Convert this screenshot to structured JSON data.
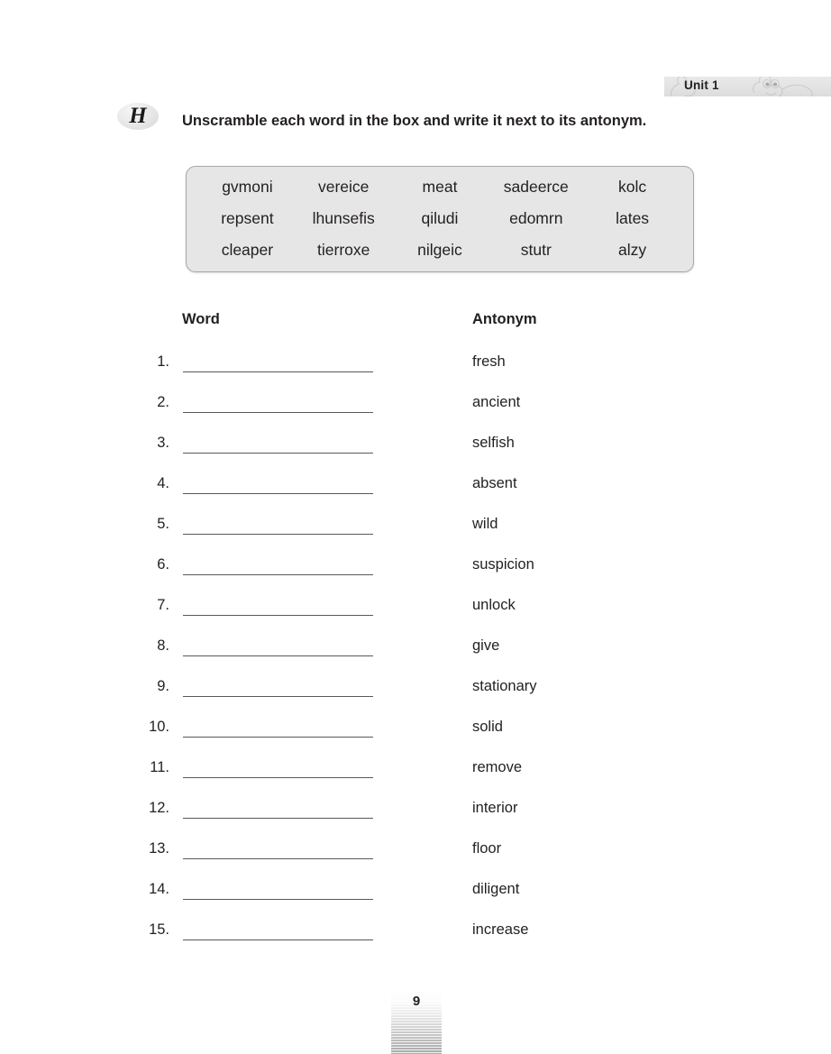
{
  "header": {
    "unit_label": "Unit 1",
    "decoration_icon": "starfish-character-icon"
  },
  "exercise": {
    "letter": "H",
    "instruction": "Unscramble each word in the box and write it next to its antonym."
  },
  "word_bank": {
    "rows": [
      [
        "gvmoni",
        "vereice",
        "meat",
        "sadeerce",
        "kolc"
      ],
      [
        "repsent",
        "lhunsefis",
        "qiludi",
        "edomrn",
        "lates"
      ],
      [
        "cleaper",
        "tierroxe",
        "nilgeic",
        "stutr",
        "alzy"
      ]
    ]
  },
  "table": {
    "headers": {
      "word": "Word",
      "antonym": "Antonym"
    },
    "rows": [
      {
        "number": "1.",
        "answer": "",
        "antonym": "fresh"
      },
      {
        "number": "2.",
        "answer": "",
        "antonym": "ancient"
      },
      {
        "number": "3.",
        "answer": "",
        "antonym": "selfish"
      },
      {
        "number": "4.",
        "answer": "",
        "antonym": "absent"
      },
      {
        "number": "5.",
        "answer": "",
        "antonym": "wild"
      },
      {
        "number": "6.",
        "answer": "",
        "antonym": "suspicion"
      },
      {
        "number": "7.",
        "answer": "",
        "antonym": "unlock"
      },
      {
        "number": "8.",
        "answer": "",
        "antonym": "give"
      },
      {
        "number": "9.",
        "answer": "",
        "antonym": "stationary"
      },
      {
        "number": "10.",
        "answer": "",
        "antonym": "solid"
      },
      {
        "number": "11.",
        "answer": "",
        "antonym": "remove"
      },
      {
        "number": "12.",
        "answer": "",
        "antonym": "interior"
      },
      {
        "number": "13.",
        "answer": "",
        "antonym": "floor"
      },
      {
        "number": "14.",
        "answer": "",
        "antonym": "diligent"
      },
      {
        "number": "15.",
        "answer": "",
        "antonym": "increase"
      }
    ]
  },
  "footer": {
    "page_number": "9"
  },
  "colors": {
    "text": "#231f20",
    "word_box_fill": "#e6e6e6",
    "word_box_border": "#a8a8a8",
    "banner_fill": "#e3e3e3",
    "rule_line": "#58595b"
  }
}
